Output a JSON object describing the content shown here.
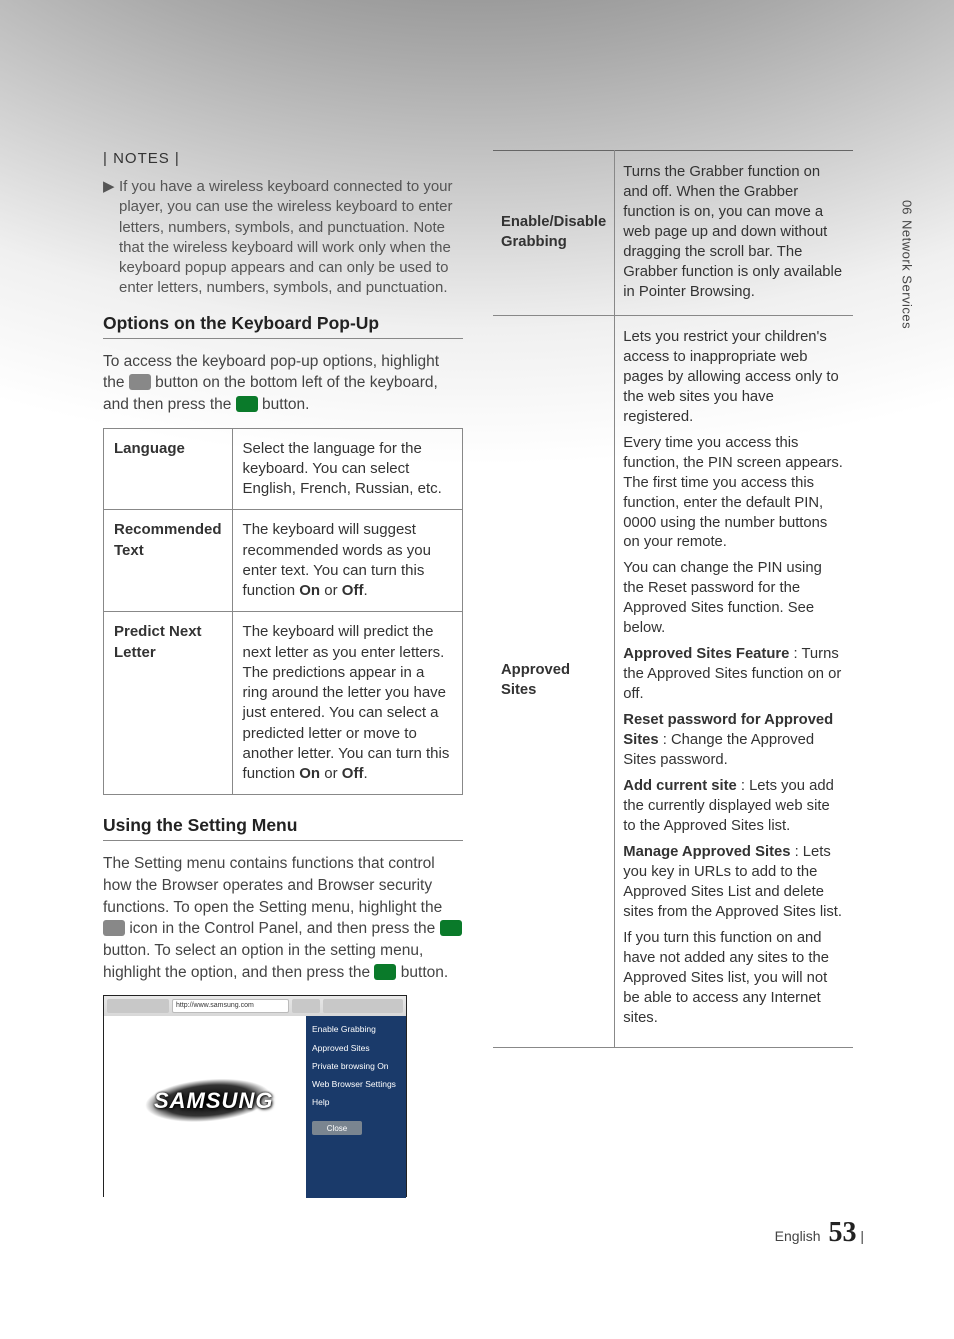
{
  "sideTab": {
    "chapter": "06",
    "title": "Network Services"
  },
  "notesLabel": "| NOTES |",
  "note": "If you have a wireless keyboard connected to your player, you can use the wireless keyboard to enter letters, numbers, symbols, and punctuation. Note that the wireless keyboard will work only when the keyboard popup appears and can only be used to enter letters, numbers, symbols, and punctuation.",
  "h_options": "Options on the Keyboard Pop-Up",
  "options_intro_pre": "To access the keyboard pop-up options, highlight the ",
  "options_intro_mid": " button on the bottom left of the keyboard, and then press the ",
  "options_intro_post": " button.",
  "kbTable": {
    "language": {
      "label": "Language",
      "desc": "Select the language for the keyboard. You can select English, French, Russian, etc."
    },
    "recommended": {
      "label": "Recommended Text",
      "desc_pre": "The keyboard will suggest recommended words as you enter text. You can turn this function ",
      "on": "On",
      "or": " or ",
      "off": "Off",
      "end": "."
    },
    "predict": {
      "label": "Predict Next Letter",
      "desc_pre": "The keyboard will predict the next letter as you enter letters. The predictions appear in a ring around the letter you have just entered. You can select a predicted letter or move to another letter. You can turn this function ",
      "on": "On",
      "or": " or ",
      "off": "Off",
      "end": "."
    }
  },
  "h_setting": "Using the Setting Menu",
  "setting_intro_1": "The Setting menu contains functions that control how the Browser operates and Browser security functions. To open the Setting menu, highlight the ",
  "setting_intro_2": " icon in the Control Panel, and then press the ",
  "setting_intro_3": " button. To select an option in the setting menu, highlight the option, and then press the ",
  "setting_intro_4": " button.",
  "mock": {
    "url": "http://www.samsung.com",
    "logo": "SAMSUNG",
    "menu": [
      "Enable Grabbing",
      "Approved Sites",
      "Private browsing On",
      "Web Browser Settings",
      "Help"
    ],
    "close": "Close"
  },
  "settings": {
    "grab": {
      "label": "Enable/Disable Grabbing",
      "desc": "Turns the Grabber function on and off. When the Grabber function is on, you can move a web page up and down without dragging the scroll bar. The Grabber function is only available in Pointer Browsing."
    },
    "approved": {
      "label": "Approved Sites",
      "p1": "Lets you restrict your children's access to inappropriate web pages by allowing access only to the web sites you have registered.",
      "p2": "Every time you access this function, the PIN screen appears. The first time you access this function, enter the default PIN, 0000 using the number buttons on your remote.",
      "p3": "You can change the PIN using the Reset password for the Approved Sites function. See below.",
      "feat_label": "Approved Sites Feature",
      "feat_desc": " : Turns the Approved Sites function on or off.",
      "reset_label": "Reset password for Approved Sites",
      "reset_desc": " : Change the Approved Sites password.",
      "add_label": "Add current site",
      "add_desc": " : Lets you add the currently displayed web site to the Approved Sites list.",
      "manage_label": "Manage Approved Sites",
      "manage_desc": " : Lets you key in URLs to add to the Approved Sites List and delete sites from the Approved Sites list.",
      "p4": "If you turn this function on and have not added any sites to the Approved Sites list, you will not be able to access any Internet sites."
    }
  },
  "footer": {
    "lang": "English",
    "page": "53"
  }
}
